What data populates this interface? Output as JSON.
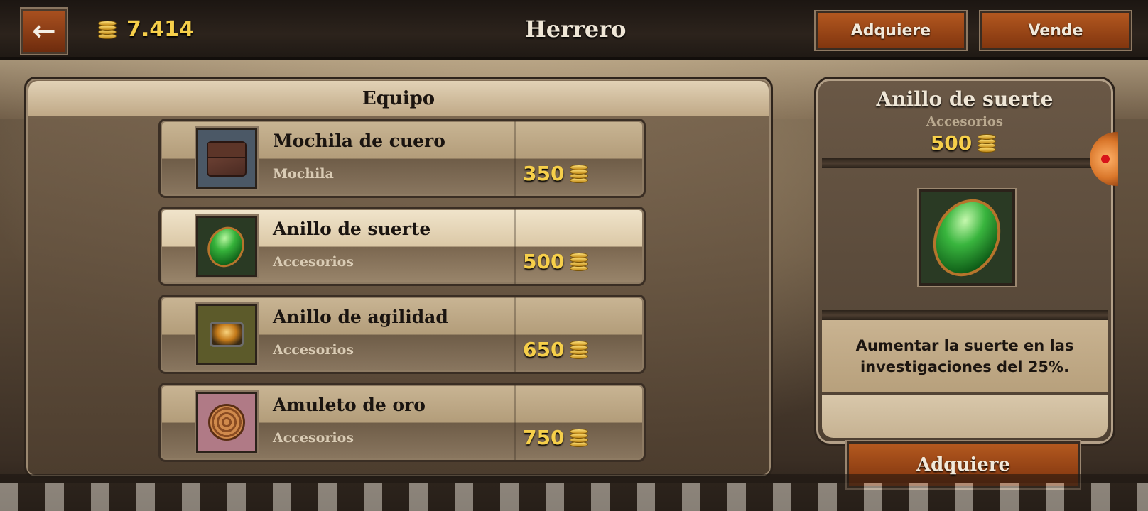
{
  "header": {
    "back_icon": "arrow-left-icon",
    "coins": "7.414",
    "title": "Herrero",
    "buy_tab_label": "Adquiere",
    "sell_tab_label": "Vende"
  },
  "list": {
    "title": "Equipo",
    "items": [
      {
        "name": "Mochila de cuero",
        "category": "Mochila",
        "price": "350",
        "icon": "leather-bag-icon"
      },
      {
        "name": "Anillo de suerte",
        "category": "Accesorios",
        "price": "500",
        "icon": "green-gem-ring-icon",
        "selected": true
      },
      {
        "name": "Anillo de agilidad",
        "category": "Accesorios",
        "price": "650",
        "icon": "amber-ring-icon"
      },
      {
        "name": "Amuleto de oro",
        "category": "Accesorios",
        "price": "750",
        "icon": "gold-amulet-icon"
      }
    ]
  },
  "detail": {
    "name": "Anillo de suerte",
    "category": "Accesorios",
    "price": "500",
    "description": "Aumentar la suerte en las investigaciones del 25%.",
    "buy_label": "Adquiere"
  },
  "colors": {
    "gold": "#f6cf4a",
    "button_orange": "#b2571f",
    "parchment": "#dbc8a6"
  }
}
